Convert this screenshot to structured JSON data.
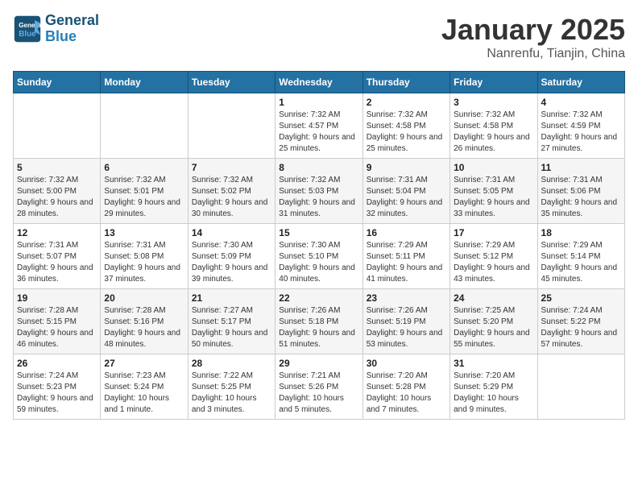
{
  "header": {
    "logo_line1": "General",
    "logo_line2": "Blue",
    "month": "January 2025",
    "location": "Nanrenfu, Tianjin, China"
  },
  "weekdays": [
    "Sunday",
    "Monday",
    "Tuesday",
    "Wednesday",
    "Thursday",
    "Friday",
    "Saturday"
  ],
  "weeks": [
    [
      {
        "day": "",
        "sunrise": "",
        "sunset": "",
        "daylight": ""
      },
      {
        "day": "",
        "sunrise": "",
        "sunset": "",
        "daylight": ""
      },
      {
        "day": "",
        "sunrise": "",
        "sunset": "",
        "daylight": ""
      },
      {
        "day": "1",
        "sunrise": "Sunrise: 7:32 AM",
        "sunset": "Sunset: 4:57 PM",
        "daylight": "Daylight: 9 hours and 25 minutes."
      },
      {
        "day": "2",
        "sunrise": "Sunrise: 7:32 AM",
        "sunset": "Sunset: 4:58 PM",
        "daylight": "Daylight: 9 hours and 25 minutes."
      },
      {
        "day": "3",
        "sunrise": "Sunrise: 7:32 AM",
        "sunset": "Sunset: 4:58 PM",
        "daylight": "Daylight: 9 hours and 26 minutes."
      },
      {
        "day": "4",
        "sunrise": "Sunrise: 7:32 AM",
        "sunset": "Sunset: 4:59 PM",
        "daylight": "Daylight: 9 hours and 27 minutes."
      }
    ],
    [
      {
        "day": "5",
        "sunrise": "Sunrise: 7:32 AM",
        "sunset": "Sunset: 5:00 PM",
        "daylight": "Daylight: 9 hours and 28 minutes."
      },
      {
        "day": "6",
        "sunrise": "Sunrise: 7:32 AM",
        "sunset": "Sunset: 5:01 PM",
        "daylight": "Daylight: 9 hours and 29 minutes."
      },
      {
        "day": "7",
        "sunrise": "Sunrise: 7:32 AM",
        "sunset": "Sunset: 5:02 PM",
        "daylight": "Daylight: 9 hours and 30 minutes."
      },
      {
        "day": "8",
        "sunrise": "Sunrise: 7:32 AM",
        "sunset": "Sunset: 5:03 PM",
        "daylight": "Daylight: 9 hours and 31 minutes."
      },
      {
        "day": "9",
        "sunrise": "Sunrise: 7:31 AM",
        "sunset": "Sunset: 5:04 PM",
        "daylight": "Daylight: 9 hours and 32 minutes."
      },
      {
        "day": "10",
        "sunrise": "Sunrise: 7:31 AM",
        "sunset": "Sunset: 5:05 PM",
        "daylight": "Daylight: 9 hours and 33 minutes."
      },
      {
        "day": "11",
        "sunrise": "Sunrise: 7:31 AM",
        "sunset": "Sunset: 5:06 PM",
        "daylight": "Daylight: 9 hours and 35 minutes."
      }
    ],
    [
      {
        "day": "12",
        "sunrise": "Sunrise: 7:31 AM",
        "sunset": "Sunset: 5:07 PM",
        "daylight": "Daylight: 9 hours and 36 minutes."
      },
      {
        "day": "13",
        "sunrise": "Sunrise: 7:31 AM",
        "sunset": "Sunset: 5:08 PM",
        "daylight": "Daylight: 9 hours and 37 minutes."
      },
      {
        "day": "14",
        "sunrise": "Sunrise: 7:30 AM",
        "sunset": "Sunset: 5:09 PM",
        "daylight": "Daylight: 9 hours and 39 minutes."
      },
      {
        "day": "15",
        "sunrise": "Sunrise: 7:30 AM",
        "sunset": "Sunset: 5:10 PM",
        "daylight": "Daylight: 9 hours and 40 minutes."
      },
      {
        "day": "16",
        "sunrise": "Sunrise: 7:29 AM",
        "sunset": "Sunset: 5:11 PM",
        "daylight": "Daylight: 9 hours and 41 minutes."
      },
      {
        "day": "17",
        "sunrise": "Sunrise: 7:29 AM",
        "sunset": "Sunset: 5:12 PM",
        "daylight": "Daylight: 9 hours and 43 minutes."
      },
      {
        "day": "18",
        "sunrise": "Sunrise: 7:29 AM",
        "sunset": "Sunset: 5:14 PM",
        "daylight": "Daylight: 9 hours and 45 minutes."
      }
    ],
    [
      {
        "day": "19",
        "sunrise": "Sunrise: 7:28 AM",
        "sunset": "Sunset: 5:15 PM",
        "daylight": "Daylight: 9 hours and 46 minutes."
      },
      {
        "day": "20",
        "sunrise": "Sunrise: 7:28 AM",
        "sunset": "Sunset: 5:16 PM",
        "daylight": "Daylight: 9 hours and 48 minutes."
      },
      {
        "day": "21",
        "sunrise": "Sunrise: 7:27 AM",
        "sunset": "Sunset: 5:17 PM",
        "daylight": "Daylight: 9 hours and 50 minutes."
      },
      {
        "day": "22",
        "sunrise": "Sunrise: 7:26 AM",
        "sunset": "Sunset: 5:18 PM",
        "daylight": "Daylight: 9 hours and 51 minutes."
      },
      {
        "day": "23",
        "sunrise": "Sunrise: 7:26 AM",
        "sunset": "Sunset: 5:19 PM",
        "daylight": "Daylight: 9 hours and 53 minutes."
      },
      {
        "day": "24",
        "sunrise": "Sunrise: 7:25 AM",
        "sunset": "Sunset: 5:20 PM",
        "daylight": "Daylight: 9 hours and 55 minutes."
      },
      {
        "day": "25",
        "sunrise": "Sunrise: 7:24 AM",
        "sunset": "Sunset: 5:22 PM",
        "daylight": "Daylight: 9 hours and 57 minutes."
      }
    ],
    [
      {
        "day": "26",
        "sunrise": "Sunrise: 7:24 AM",
        "sunset": "Sunset: 5:23 PM",
        "daylight": "Daylight: 9 hours and 59 minutes."
      },
      {
        "day": "27",
        "sunrise": "Sunrise: 7:23 AM",
        "sunset": "Sunset: 5:24 PM",
        "daylight": "Daylight: 10 hours and 1 minute."
      },
      {
        "day": "28",
        "sunrise": "Sunrise: 7:22 AM",
        "sunset": "Sunset: 5:25 PM",
        "daylight": "Daylight: 10 hours and 3 minutes."
      },
      {
        "day": "29",
        "sunrise": "Sunrise: 7:21 AM",
        "sunset": "Sunset: 5:26 PM",
        "daylight": "Daylight: 10 hours and 5 minutes."
      },
      {
        "day": "30",
        "sunrise": "Sunrise: 7:20 AM",
        "sunset": "Sunset: 5:28 PM",
        "daylight": "Daylight: 10 hours and 7 minutes."
      },
      {
        "day": "31",
        "sunrise": "Sunrise: 7:20 AM",
        "sunset": "Sunset: 5:29 PM",
        "daylight": "Daylight: 10 hours and 9 minutes."
      },
      {
        "day": "",
        "sunrise": "",
        "sunset": "",
        "daylight": ""
      }
    ]
  ]
}
